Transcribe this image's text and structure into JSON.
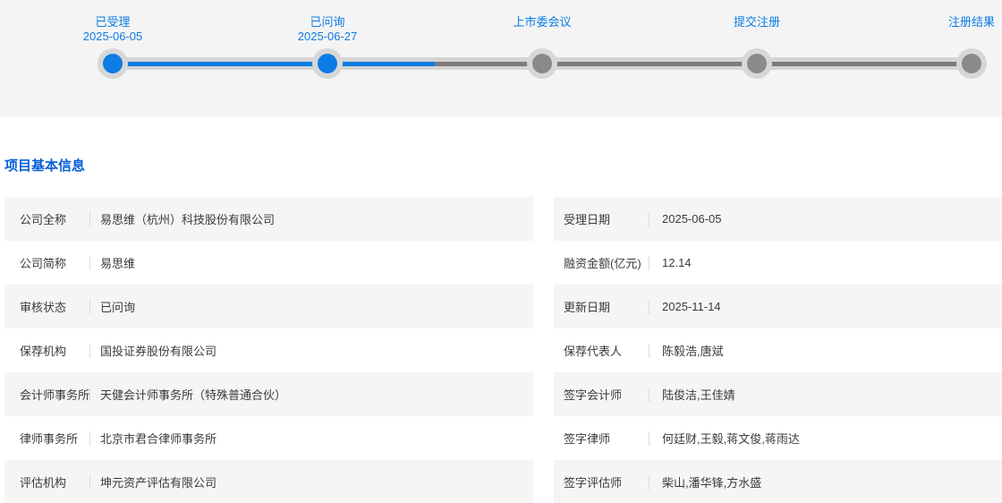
{
  "colors": {
    "accent_blue": "#0d7ce4",
    "title_blue": "#0760d8",
    "inactive_line": "#7c7c7c",
    "inactive_node": "#8a8a8a",
    "track": "#d4d4d4",
    "ring": "#d7d7d7",
    "panel_bg": "#f4f4f4",
    "row_alt_bg": "#f5f5f3",
    "text": "#3a3a3a"
  },
  "stepper": {
    "steps": [
      {
        "label": "已受理",
        "date": "2025-06-05",
        "state": "done"
      },
      {
        "label": "已问询",
        "date": "2025-06-27",
        "state": "done"
      },
      {
        "label": "上市委会议",
        "date": "",
        "state": "pending"
      },
      {
        "label": "提交注册",
        "date": "",
        "state": "pending"
      },
      {
        "label": "注册结果",
        "date": "",
        "state": "pending"
      }
    ]
  },
  "section": {
    "title": "项目基本信息"
  },
  "info_table": {
    "left_rows": [
      {
        "label": "公司全称",
        "value": "易思维（杭州）科技股份有限公司"
      },
      {
        "label": "公司简称",
        "value": "易思维"
      },
      {
        "label": "审核状态",
        "value": "已问询"
      },
      {
        "label": "保荐机构",
        "value": "国投证券股份有限公司"
      },
      {
        "label": "会计师事务所",
        "value": "天健会计师事务所（特殊普通合伙）"
      },
      {
        "label": "律师事务所",
        "value": "北京市君合律师事务所"
      },
      {
        "label": "评估机构",
        "value": "坤元资产评估有限公司"
      }
    ],
    "right_rows": [
      {
        "label": "受理日期",
        "value": "2025-06-05"
      },
      {
        "label": "融资金额(亿元)",
        "value": "12.14"
      },
      {
        "label": "更新日期",
        "value": "2025-11-14"
      },
      {
        "label": "保荐代表人",
        "value": "陈毅浩,唐斌"
      },
      {
        "label": "签字会计师",
        "value": "陆俊洁,王佳婧"
      },
      {
        "label": "签字律师",
        "value": "何廷财,王毅,蒋文俊,蒋雨达"
      },
      {
        "label": "签字评估师",
        "value": "柴山,潘华锋,方水盛"
      }
    ]
  }
}
